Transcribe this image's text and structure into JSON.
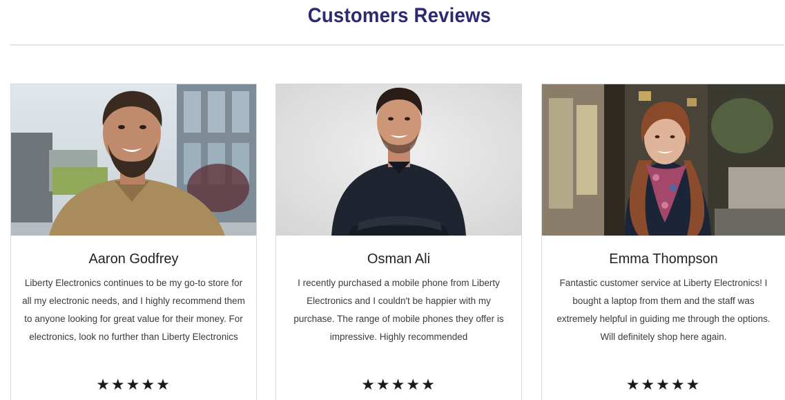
{
  "section": {
    "title": "Customers Reviews"
  },
  "reviews": [
    {
      "name": "Aaron Godfrey",
      "text": "Liberty Electronics continues to be my go-to store for all my electronic needs, and I highly recommend them to anyone looking for great value for their money. For electronics, look no further than Liberty Electronics",
      "rating": 5,
      "stars": "★★★★★"
    },
    {
      "name": "Osman Ali",
      "text": "I recently purchased a mobile phone from Liberty Electronics and I couldn't be happier with my purchase. The range of mobile phones they offer is impressive. Highly recommended",
      "rating": 5,
      "stars": "★★★★★"
    },
    {
      "name": "Emma Thompson",
      "text": "Fantastic customer service at Liberty Electronics! I bought a laptop from them and the staff was extremely helpful in guiding me through the options. Will definitely shop here again.",
      "rating": 5,
      "stars": "★★★★★"
    }
  ],
  "colors": {
    "title": "#2e2a72",
    "divider": "#e4e4ea",
    "card_border": "#d8d8d8",
    "text": "#3a3a3a",
    "stars": "#1a1a1a"
  }
}
